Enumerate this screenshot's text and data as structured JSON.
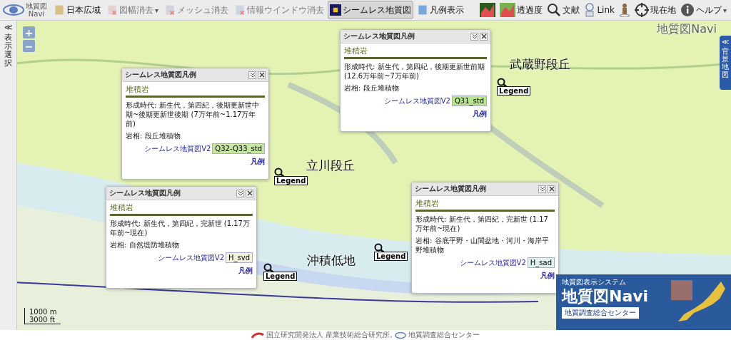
{
  "logo": {
    "text": "地質図",
    "sub": "Navi"
  },
  "toolbar": [
    {
      "label": "日本広域",
      "disabled": false,
      "selected": false
    },
    {
      "label": "図幅消去",
      "disabled": true,
      "selected": false,
      "caret": "▾"
    },
    {
      "label": "メッシュ消去",
      "disabled": true,
      "selected": false
    },
    {
      "label": "情報ウインドウ消去",
      "disabled": true,
      "selected": false
    },
    {
      "label": "シームレス地質図",
      "disabled": false,
      "selected": true
    },
    {
      "label": "凡例表示",
      "disabled": false,
      "selected": false
    }
  ],
  "toolbar_right": [
    {
      "label": "透過度"
    },
    {
      "label": "文献"
    },
    {
      "label": "Link"
    },
    {
      "label": "現在地"
    },
    {
      "label": "ヘルプ",
      "caret": "▾"
    }
  ],
  "side_tab_left": {
    "arrow": "≪",
    "label": "表示選択"
  },
  "side_tab_right": {
    "arrow": "≪",
    "label": "背景地図"
  },
  "zoom": {
    "in": "+",
    "out": "−"
  },
  "map_title": "地質図Navi",
  "map_labels": [
    "武蔵野段丘",
    "立川段丘",
    "沖積低地"
  ],
  "legend_markers": [
    "Legend",
    "Legend",
    "Legend",
    "Legend"
  ],
  "popups": [
    {
      "title": "シームレス地質図凡例",
      "heading": "堆積岩",
      "age": "形成時代: 新生代，第四紀，後期更新世中期~後期更新世後期 (7万年前~1.17万年前)",
      "lithology": "岩相: 段丘堆積物",
      "source": "シームレス地質図V2",
      "code": "Q32-Q33_std",
      "color": "#c6e6a2",
      "legend": "凡例"
    },
    {
      "title": "シームレス地質図凡例",
      "heading": "堆積岩",
      "age": "形成時代: 新生代，第四紀，後期更新世前期 (12.6万年前~7万年前)",
      "lithology": "岩相: 段丘堆積物",
      "source": "シームレス地質図V2",
      "code": "Q31_std",
      "color": "#b9e68c",
      "legend": "凡例"
    },
    {
      "title": "シームレス地質図凡例",
      "heading": "堆積岩",
      "age": "形成時代: 新生代，第四紀，完新世 (1.17万年前~現在)",
      "lithology": "岩相: 自然堤防堆積物",
      "source": "シームレス地質図V2",
      "code": "H_svd",
      "color": "#f3f3dc",
      "legend": "凡例"
    },
    {
      "title": "シームレス地質図凡例",
      "heading": "堆積岩",
      "age": "形成時代: 新生代，第四紀，完新世 (1.17万年前~現在)",
      "lithology": "岩相: 谷底平野・山間盆地・河川・海岸平野堆積物",
      "source": "シームレス地質図V2",
      "code": "H_sad",
      "color": "#e0f2ef",
      "legend": "凡例"
    }
  ],
  "scale": {
    "metric": "1000 m",
    "imperial": "3000 ft"
  },
  "banner": {
    "subtitle": "地質図表示システム",
    "title": "地質図Navi",
    "org": "地質調査総合センター"
  },
  "footer": {
    "org1": "国立研究開発法人 産業技術総合研究所,",
    "org2": "地質調査総合センター"
  }
}
